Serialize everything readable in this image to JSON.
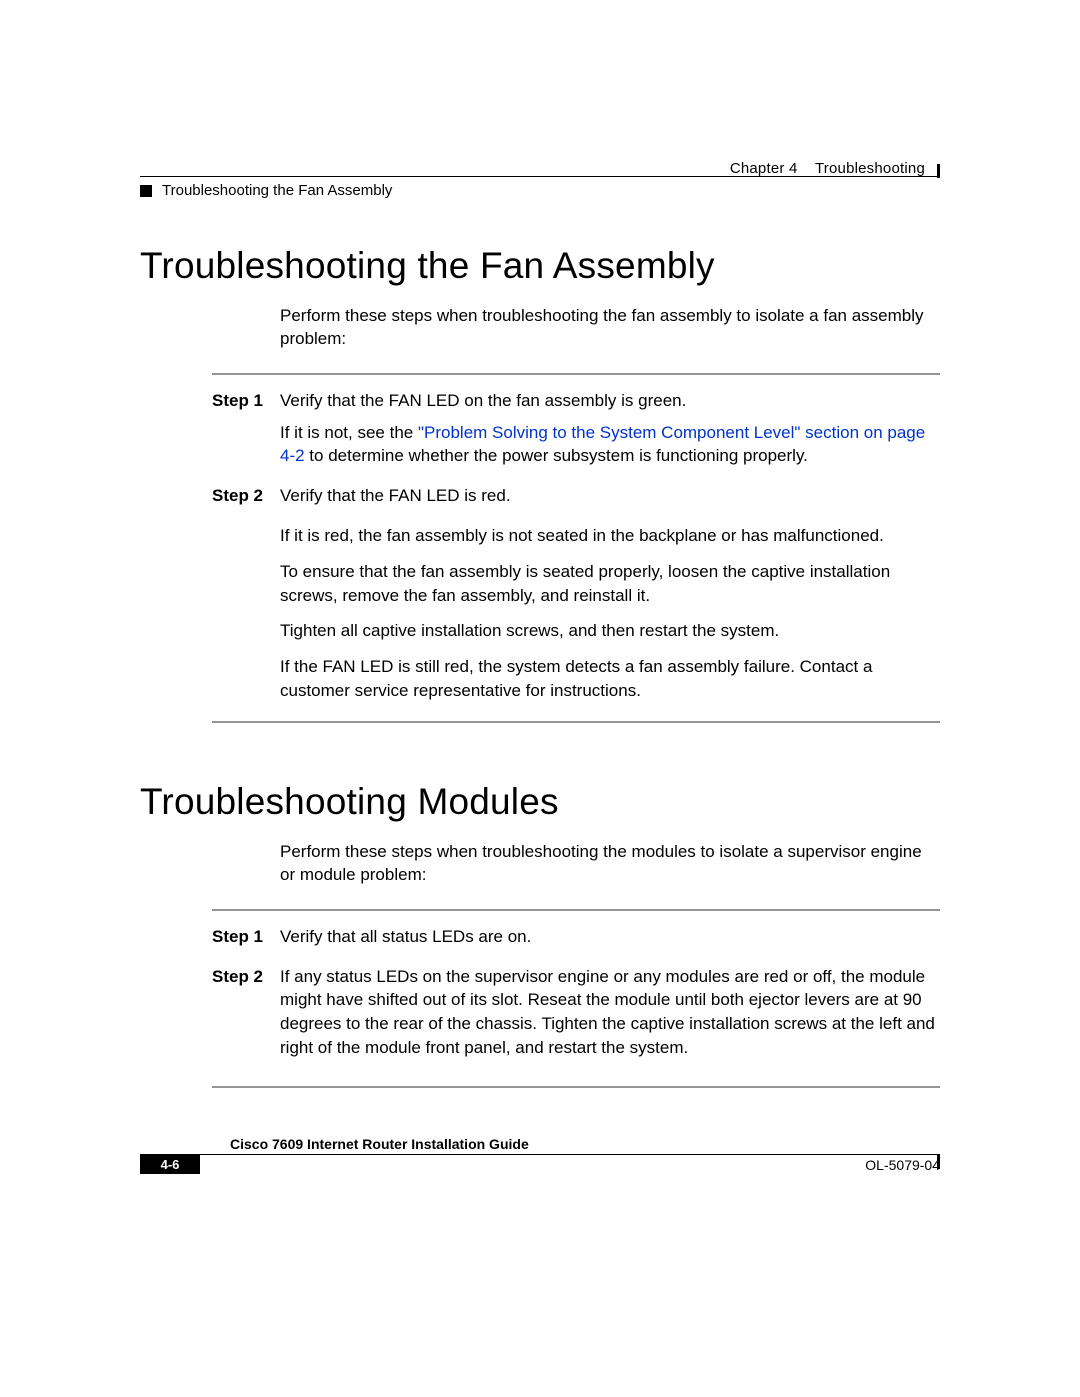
{
  "header": {
    "chapter_label": "Chapter 4",
    "chapter_title": "Troubleshooting",
    "section_title": "Troubleshooting the Fan Assembly"
  },
  "section_fan": {
    "heading": "Troubleshooting the Fan Assembly",
    "intro": "Perform these steps when troubleshooting the fan assembly to isolate a fan assembly problem:",
    "step1_label": "Step 1",
    "step1_line1": "Verify that the FAN LED on the fan assembly is green.",
    "step1_line2_pre": "If it is not, see the ",
    "step1_link": "\"Problem Solving to the System Component Level\" section on page 4-2",
    "step1_line2_post": " to determine whether the power subsystem is functioning properly.",
    "step2_label": "Step 2",
    "step2_line1": "Verify that the FAN LED is red.",
    "sub_p1": "If it is red, the fan assembly is not seated in the backplane or has malfunctioned.",
    "sub_p2": "To ensure that the fan assembly is seated properly, loosen the captive installation screws, remove the fan assembly, and reinstall it.",
    "sub_p3": "Tighten all captive installation screws, and then restart the system.",
    "sub_p4": "If the FAN LED is still red, the system detects a fan assembly failure. Contact a customer service representative for instructions."
  },
  "section_modules": {
    "heading": "Troubleshooting Modules",
    "intro": "Perform these steps when troubleshooting the modules to isolate a supervisor engine or module problem:",
    "step1_label": "Step 1",
    "step1_line1": "Verify that all status LEDs are on.",
    "step2_label": "Step 2",
    "step2_line1": "If any status LEDs on the supervisor engine or any modules are red or off, the module might have shifted out of its slot. Reseat the module until both ejector levers are at 90 degrees to the rear of the chassis. Tighten the captive installation screws at the left and right of the module front panel, and restart the system."
  },
  "footer": {
    "book_title": "Cisco 7609 Internet Router Installation Guide",
    "page_number": "4-6",
    "doc_id": "OL-5079-04"
  }
}
